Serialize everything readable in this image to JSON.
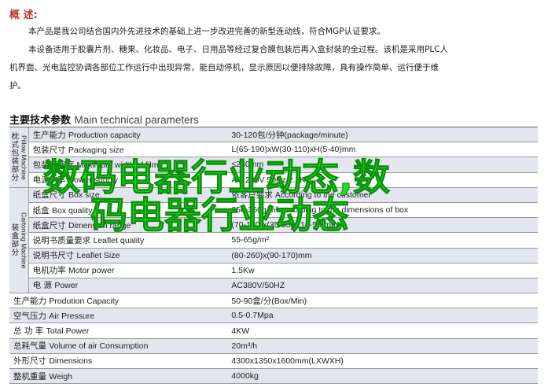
{
  "overview": {
    "title": "概  述:",
    "lines": [
      "本产品是我公司结合国内外先进技术的基础上进一步改进完善的新型连动线，符合MGP认证要求。",
      "本设备适用于胶囊片剂、糖果、化妆品、电子、日用品等经过复合膜包装后再入盒封装的全过程。该机是采用PLC人",
      "机界面、光电监控协调各部位工作运行中出现异常，能自动停机，显示原因以便排除故障，具有操作简单、运行便于维",
      "护。"
    ]
  },
  "params": {
    "title_cn": "主要技术参数",
    "title_en": "Main technical parameters"
  },
  "groups": {
    "pillow": {
      "cn": "枕式包装部分",
      "en": "Pillow Machine"
    },
    "carton": {
      "cn": "装盒部分",
      "en": "Cartoning Machine"
    }
  },
  "rows": [
    {
      "group": "pillow",
      "cn": "生产能力",
      "en": "Production capacity",
      "value": "30-120包/分钟(package/minute)"
    },
    {
      "group": "pillow",
      "cn": "包装尺寸",
      "en": "Packaging size",
      "value": "L(65-190)xW(30-110)xH(5-40)mm"
    },
    {
      "group": "pillow",
      "cn": "包装膜宽度",
      "en": "Maximum width of film",
      "value": "≤250mm"
    },
    {
      "group": "pillow",
      "cn": "电源功率",
      "en": "Power supply",
      "value": "AC 220V 50Hz 2.4Kw"
    },
    {
      "group": "carton",
      "cn": "纸盒尺寸",
      "en": "Box size",
      "value": "依客户要求 According to the customer"
    },
    {
      "group": "carton",
      "cn": "纸盒",
      "en": "Box quality",
      "value": "250-350g/m² according to the dimensions of box"
    },
    {
      "group": "carton",
      "cn": "纸盒尺寸",
      "en": "Dimension range",
      "value": "(70-180)x(35-85)x(14-50)mm"
    },
    {
      "group": "carton",
      "cn": "说明书质量要求",
      "en": "Leaflet quality",
      "value": "55-65g/m²"
    },
    {
      "group": "carton",
      "cn": "说明书尺寸",
      "en": "Leaflet Size",
      "value": "(80-260)x(90-170)mm"
    },
    {
      "group": "carton",
      "cn": "电机功率",
      "en": "Motor power",
      "value": "1.5Kw"
    },
    {
      "group": "carton",
      "cn": "电    源",
      "en": "Power",
      "value": "AC380V/50HZ"
    },
    {
      "group": null,
      "cn": "生产能力",
      "en": "Prodution Capacity",
      "value": "50-90盒/分(Box/Min)"
    },
    {
      "group": null,
      "cn": "空气压力",
      "en": "Air Pressure",
      "value": "0.5-0.7Mpa"
    },
    {
      "group": null,
      "cn": "总 功 率",
      "en": "Total Power",
      "value": "4KW"
    },
    {
      "group": null,
      "cn": "总耗气量",
      "en": "Volume of air Consumption",
      "value": "20m³/h"
    },
    {
      "group": null,
      "cn": "外形尺寸",
      "en": "Dimensions",
      "value": "4300x1350x1600mm(LXWXH)"
    },
    {
      "group": null,
      "cn": "整机重量",
      "en": "Weigh",
      "value": "4000kg"
    }
  ],
  "watermark": {
    "line1": "数码电器行业动态,数",
    "line2": "码电器行业动态",
    "color": "#1fe21f"
  }
}
